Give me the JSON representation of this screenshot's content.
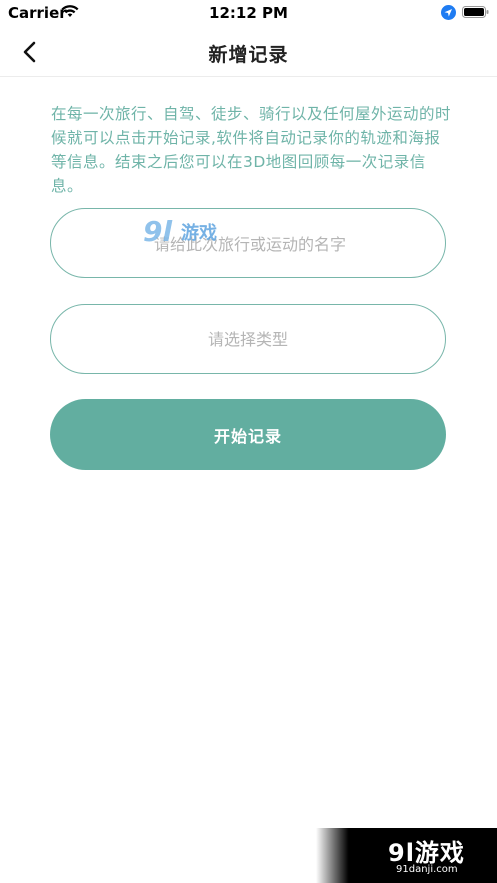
{
  "status_bar": {
    "carrier": "Carrier",
    "time": "12:12 PM",
    "wifi_icon": "wifi-icon",
    "location_icon": "location-arrow-icon",
    "battery_icon": "battery-icon"
  },
  "nav": {
    "title": "新增记录",
    "back_icon": "chevron-left-icon"
  },
  "intro_text": "在每一次旅行、自驾、徒步、骑行以及任何屋外运动的时候就可以点击开始记录,软件将自动记录你的轨迹和海报等信息。结束之后您可以在3D地图回顾每一次记录信息。",
  "form": {
    "name_placeholder": "请给此次旅行或运动的名字",
    "name_value": "",
    "type_placeholder": "请选择类型",
    "start_label": "开始记录"
  },
  "watermark": {
    "center_num": "9l",
    "center_text": "游戏",
    "corner_logo": "9l游戏",
    "corner_site": "91danji.com"
  },
  "colors": {
    "accent": "#62aea0",
    "intro_text": "#6fb4a8",
    "field_border": "#78b6aa"
  }
}
